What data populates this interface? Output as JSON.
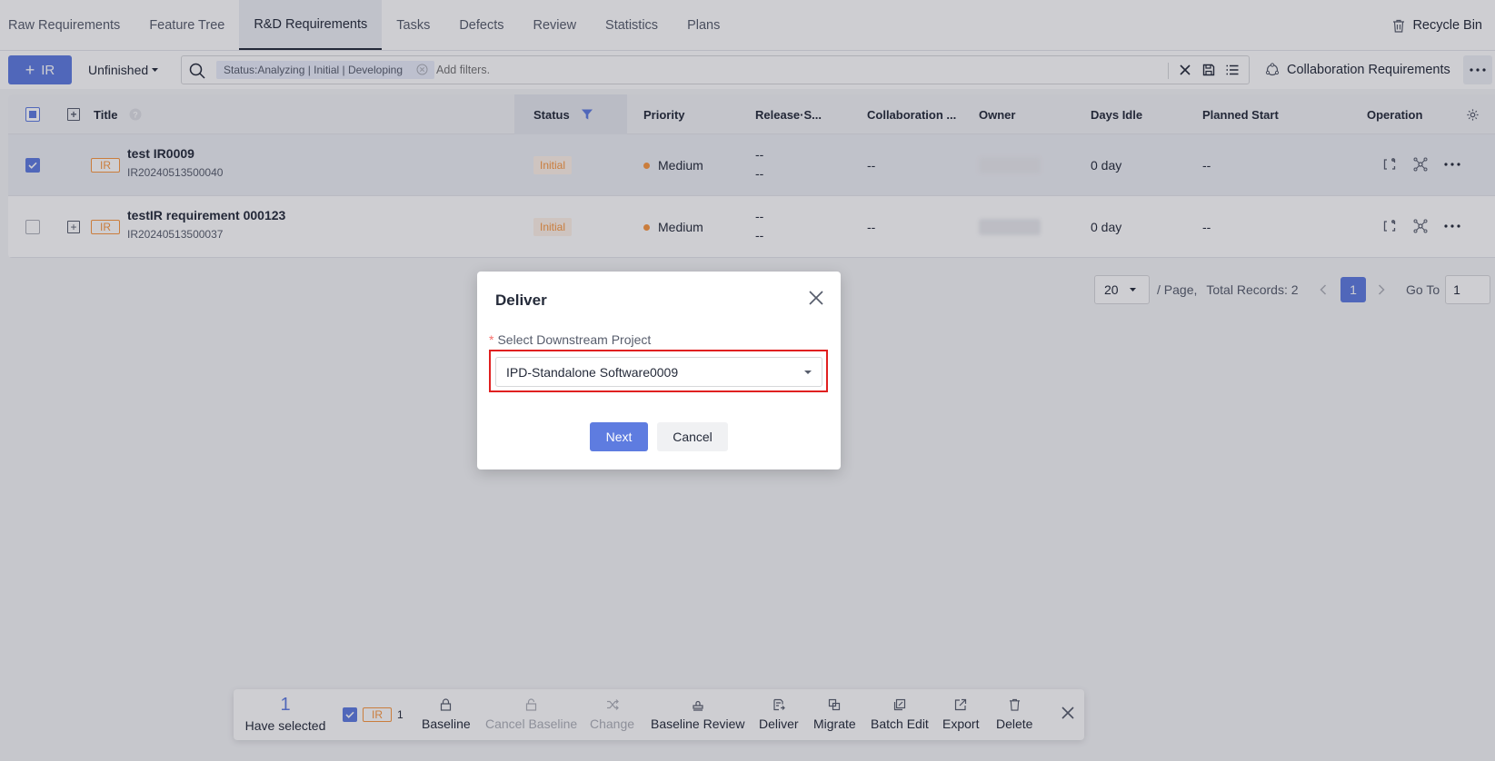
{
  "tabs": [
    {
      "label": "Raw Requirements",
      "active": false
    },
    {
      "label": "Feature Tree",
      "active": false
    },
    {
      "label": "R&D Requirements",
      "active": true
    },
    {
      "label": "Tasks",
      "active": false
    },
    {
      "label": "Defects",
      "active": false
    },
    {
      "label": "Review",
      "active": false
    },
    {
      "label": "Statistics",
      "active": false
    },
    {
      "label": "Plans",
      "active": false
    }
  ],
  "recycle_bin": "Recycle Bin",
  "toolbar": {
    "add_label": "IR",
    "filter_label": "Unfinished",
    "filter_chip": "Status:Analyzing | Initial | Developing",
    "search_placeholder": "Add filters.",
    "collaboration_label": "Collaboration Requirements"
  },
  "table": {
    "headers": {
      "title": "Title",
      "status": "Status",
      "priority": "Priority",
      "release": "Release·S...",
      "collaboration": "Collaboration ...",
      "owner": "Owner",
      "days_idle": "Days Idle",
      "planned_start": "Planned Start",
      "operation": "Operation"
    },
    "rows": [
      {
        "title": "test IR0009",
        "id": "IR20240513500040",
        "type": "IR",
        "status": "Initial",
        "priority": "Medium",
        "release_1": "--",
        "release_2": "--",
        "collaboration": "--",
        "days_idle": "0 day",
        "planned_start": "--",
        "selected": true
      },
      {
        "title": "testIR requirement 000123",
        "id": "IR20240513500037",
        "type": "IR",
        "status": "Initial",
        "priority": "Medium",
        "release_1": "--",
        "release_2": "--",
        "collaboration": "--",
        "days_idle": "0 day",
        "planned_start": "--",
        "selected": false
      }
    ]
  },
  "pagination": {
    "page_size": "20",
    "per_page_label": "/ Page,",
    "total": "Total Records: 2",
    "current": "1",
    "goto_label": "Go To",
    "goto_value": "1"
  },
  "modal": {
    "title": "Deliver",
    "field_label": "Select Downstream Project",
    "required_mark": "*",
    "selected_project": "IPD-Standalone Software0009",
    "next_label": "Next",
    "cancel_label": "Cancel"
  },
  "actionbar": {
    "selected_count": "1",
    "selected_label": "Have selected",
    "ir_tag": "IR",
    "ir_count": "1",
    "actions": {
      "baseline": "Baseline",
      "cancel_baseline": "Cancel Baseline",
      "change": "Change",
      "baseline_review": "Baseline Review",
      "deliver": "Deliver",
      "migrate": "Migrate",
      "batch_edit": "Batch Edit",
      "export": "Export",
      "delete": "Delete"
    }
  },
  "colors": {
    "primary": "#5e7ce0",
    "warning": "#fa9841",
    "highlight_border": "#e02020"
  }
}
